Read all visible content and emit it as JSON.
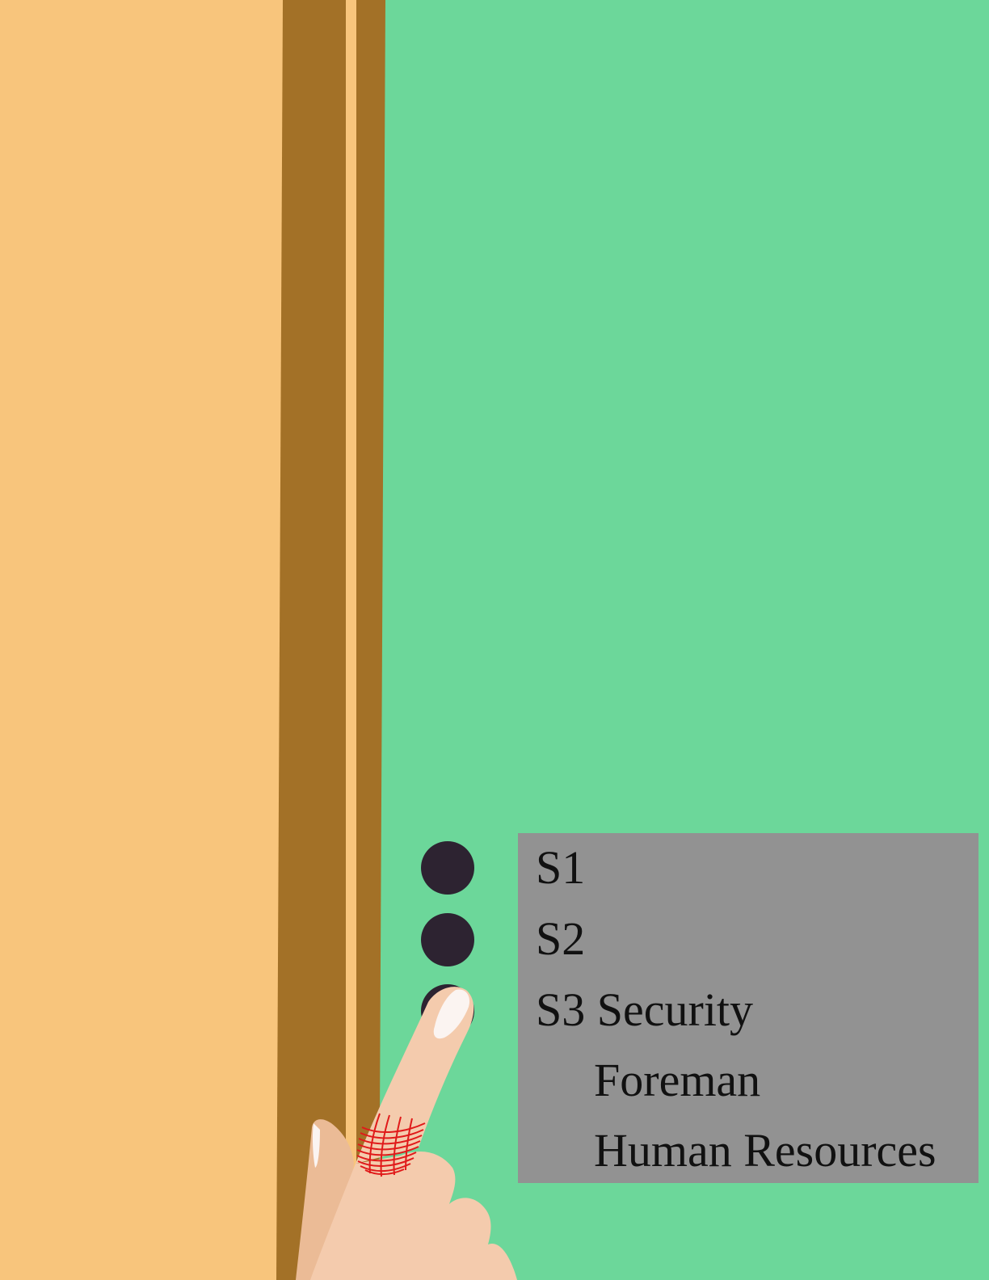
{
  "colors": {
    "wall_background": "#6cd79a",
    "door": "#f8c57c",
    "door_frame": "#a37127",
    "button": "#2d2331",
    "label_panel": "#929292",
    "skin": "#f4cbad",
    "skin_shadow": "#ebbb96",
    "nail": "#fbf4f1",
    "thread_ring": "#e01a1a"
  },
  "buttons": [
    {
      "id": "S1",
      "label": "S1"
    },
    {
      "id": "S2",
      "label": "S2"
    },
    {
      "id": "S3",
      "label": "S3 Security",
      "extra_lines": [
        "Foreman",
        "Human Resources"
      ],
      "pressed": true
    }
  ],
  "icons": {
    "pointing_hand": "hand-pointing-icon",
    "ring": "red-thread-ring-icon"
  }
}
